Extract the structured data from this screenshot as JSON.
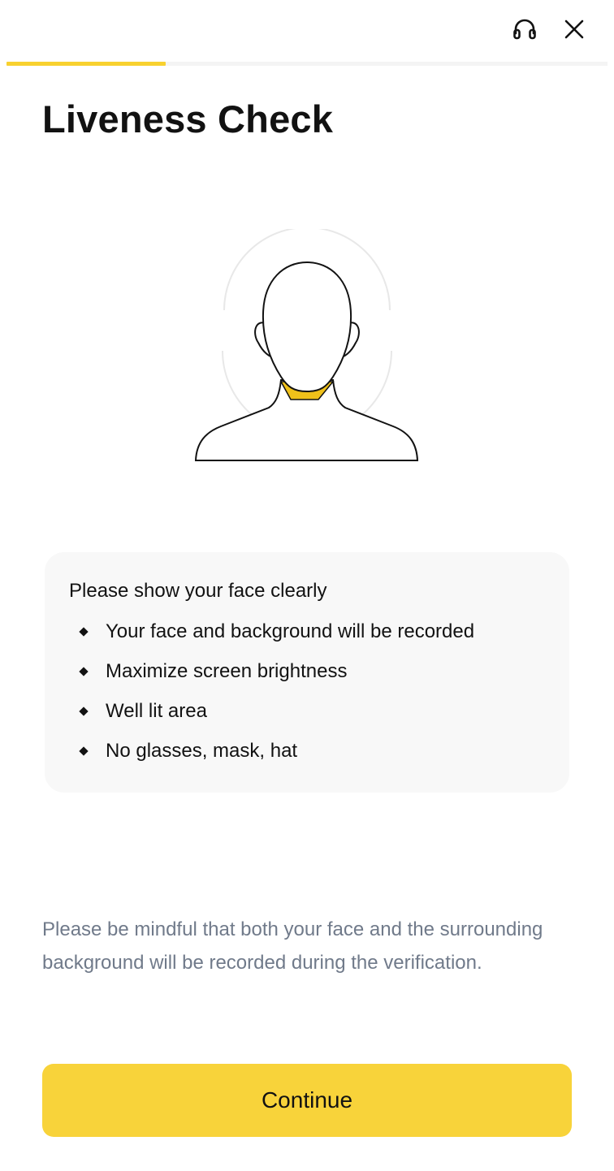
{
  "header": {
    "support_icon": "headset-icon",
    "close_icon": "close-icon"
  },
  "progress": {
    "fraction": 0.265,
    "color": "#f8d12f"
  },
  "page": {
    "title": "Liveness Check"
  },
  "illustration": {
    "icon": "face-outline-icon",
    "accent_color": "#f0c11a"
  },
  "tips": {
    "heading": "Please show your face clearly",
    "items": [
      "Your face and background will be recorded",
      "Maximize screen brightness",
      "Well lit area",
      "No glasses, mask, hat"
    ]
  },
  "notice": {
    "text": "Please be mindful that both your face and the surrounding background will be recorded during the verification."
  },
  "actions": {
    "continue_label": "Continue",
    "accent_color": "#f8d33a"
  }
}
